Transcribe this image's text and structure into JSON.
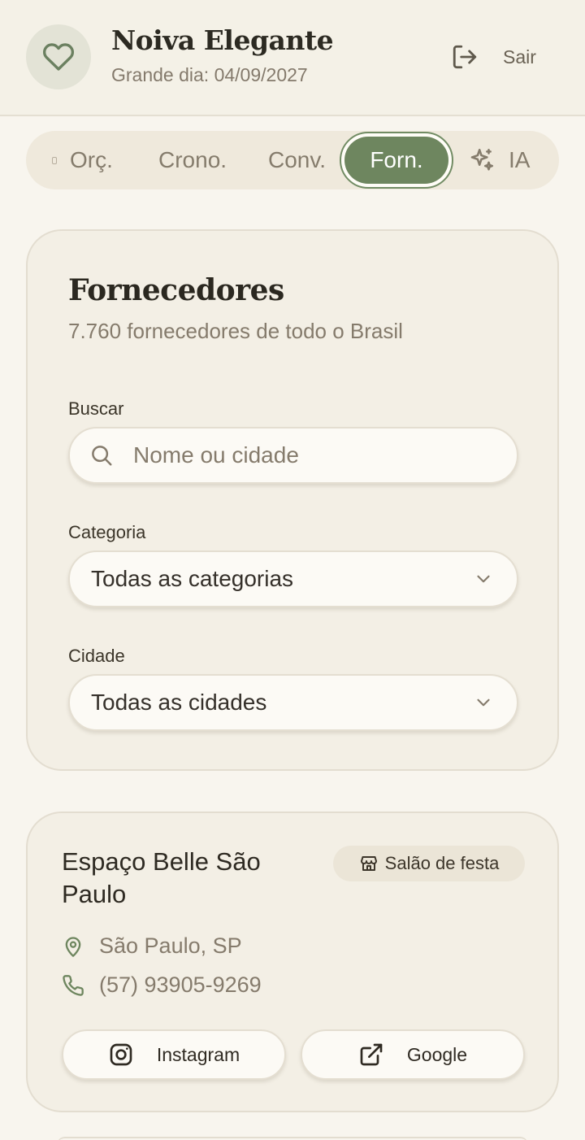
{
  "header": {
    "title": "Noiva Elegante",
    "subtitle": "Grande dia: 04/09/2027",
    "logout_label": "Sair"
  },
  "tabs": [
    {
      "label": "Orç."
    },
    {
      "label": "Crono."
    },
    {
      "label": "Conv."
    },
    {
      "label": "Forn.",
      "active": true
    },
    {
      "label": "IA"
    }
  ],
  "filters": {
    "title": "Fornecedores",
    "subtitle": "7.760 fornecedores de todo o Brasil",
    "search_label": "Buscar",
    "search_placeholder": "Nome ou cidade",
    "category_label": "Categoria",
    "category_value": "Todas as categorias",
    "city_label": "Cidade",
    "city_value": "Todas as cidades"
  },
  "vendors": [
    {
      "name": "Espaço Belle São Paulo",
      "category": "Salão de festa",
      "location": "São Paulo, SP",
      "phone": "(57) 93905-9269",
      "instagram_label": "Instagram",
      "google_label": "Google"
    }
  ],
  "colors": {
    "accent": "#6e865f",
    "background": "#f8f5ee",
    "card": "#f3efe5"
  }
}
